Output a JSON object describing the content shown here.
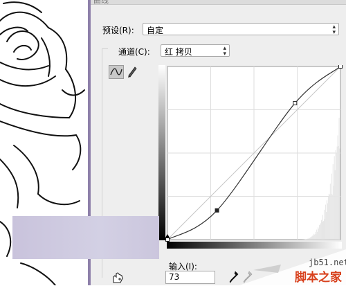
{
  "dialog": {
    "title": "曲线",
    "preset_label": "预设(R):",
    "preset_value": "自定",
    "channel_label": "通道(C):",
    "channel_value": "红 拷贝",
    "input_label": "输入(I):",
    "input_value": "73"
  },
  "curve": {
    "range": [
      0,
      255
    ],
    "control_points": [
      [
        0,
        0
      ],
      [
        73,
        43
      ],
      [
        188,
        201
      ],
      [
        255,
        255
      ]
    ],
    "grid_divisions": 4
  },
  "icons": {
    "curve_tool": "curve-edit-icon",
    "pencil_tool": "pencil-icon",
    "hand_tool": "hand-adjust-icon",
    "black_eyedropper": "black-eyedropper-icon",
    "gray_eyedropper": "gray-eyedropper-icon"
  },
  "colors": {
    "canvas_edge": "#8d7fa9",
    "overlay": "#cfcbe0",
    "watermark_text": "#d8401c"
  },
  "watermark": {
    "url": "jb51.net",
    "name": "脚本之家"
  }
}
